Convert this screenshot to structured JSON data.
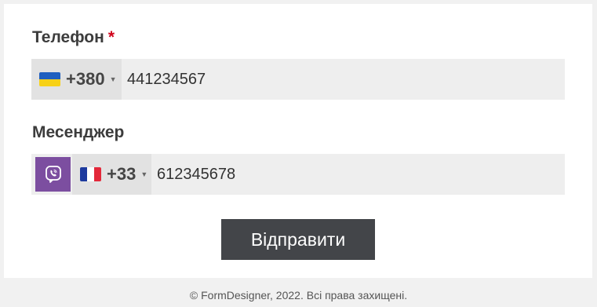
{
  "form": {
    "phone_field": {
      "label": "Телефон",
      "required_mark": "*",
      "country_code": "+380",
      "country_flag": "flag-ukraine-icon",
      "value": "441234567"
    },
    "messenger_field": {
      "label": "Месенджер",
      "messenger_icon": "viber-icon",
      "messenger_color": "#7c4ea0",
      "country_code": "+33",
      "country_flag": "flag-france-icon",
      "value": "612345678"
    },
    "submit_label": "Відправити",
    "submit_color": "#434549"
  },
  "footer": {
    "text": "© FormDesigner, 2022. Всі права захищені."
  }
}
